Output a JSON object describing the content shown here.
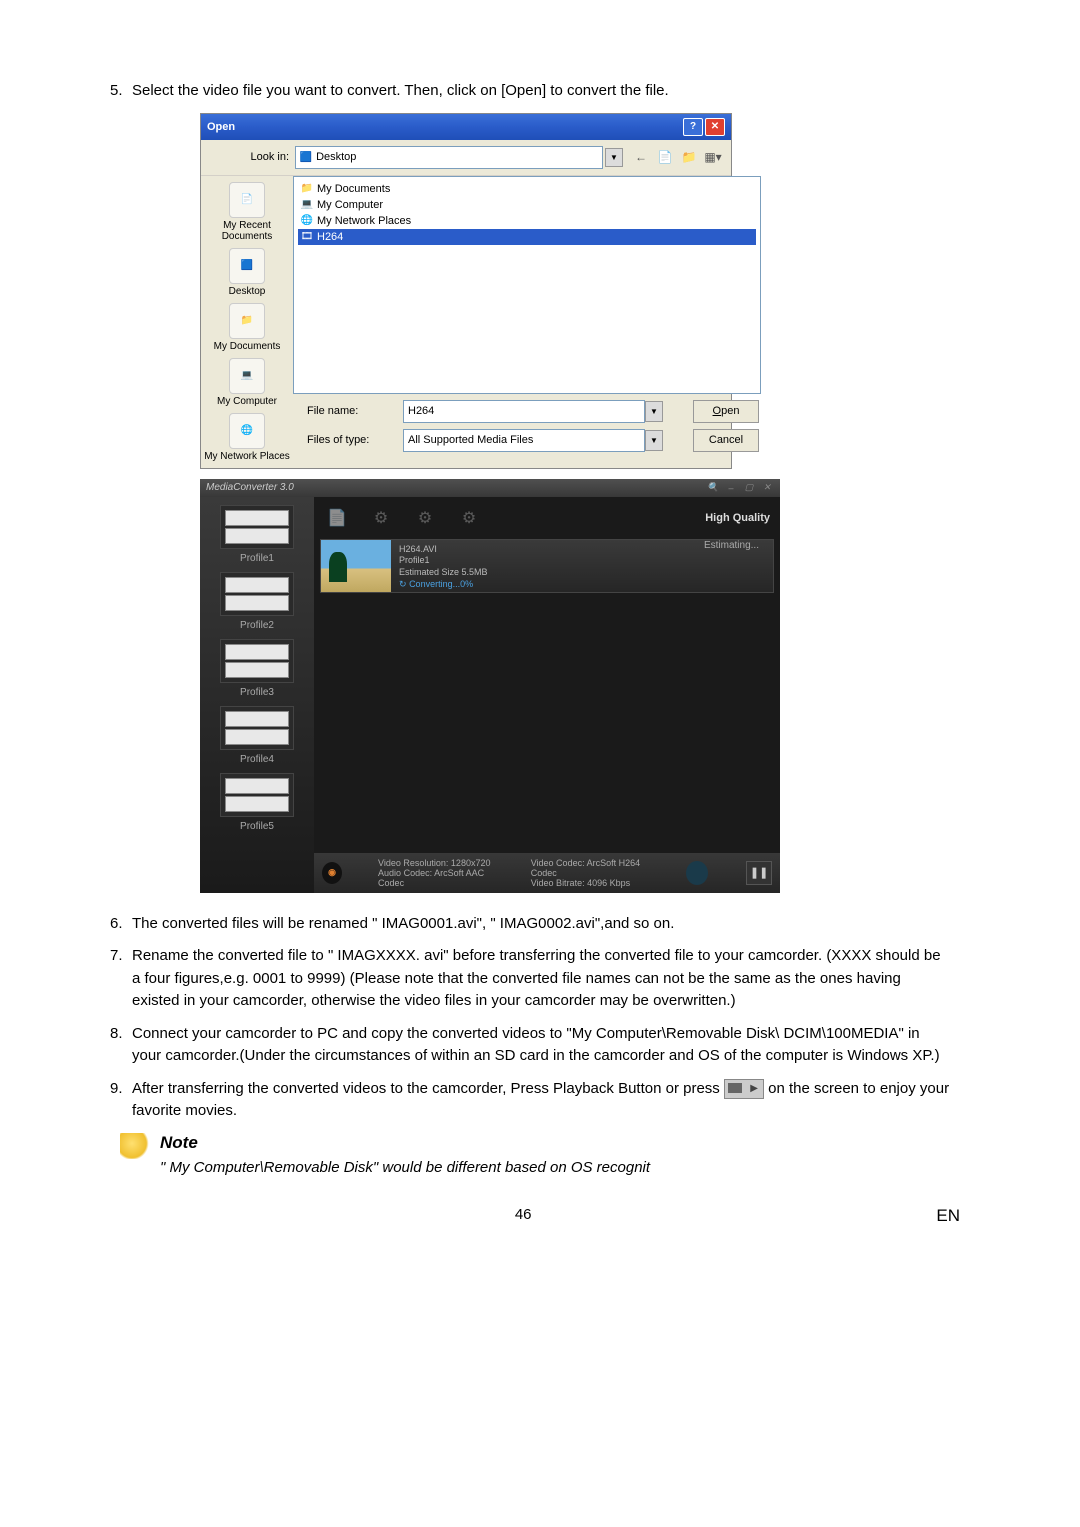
{
  "steps": {
    "5": "Select the video file you want to convert. Then, click on [Open] to convert the file.",
    "6": "The converted files will be renamed \" IMAG0001.avi\", \" IMAG0002.avi\",and so on.",
    "7": "Rename the converted file to \" IMAGXXXX. avi\" before transferring the converted file to your camcorder. (XXXX should be a four figures,e.g. 0001 to 9999) (Please note that the converted file names can not be the same as the ones having existed in your camcorder, otherwise the video files in your camcorder may be overwritten.)",
    "8": "Connect your camcorder to PC and copy the converted videos to \"My Computer\\Removable Disk\\ DCIM\\100MEDIA\" in your camcorder.(Under the circumstances of within an SD card in the camcorder and OS of the computer is Windows XP.)",
    "9a": "After transferring the converted videos to the camcorder, Press Playback Button or press ",
    "9b": " on the screen to enjoy your favorite movies."
  },
  "dlg": {
    "title": "Open",
    "lookin_label": "Look in:",
    "lookin_value": "Desktop",
    "items": {
      "mydocs": "My Documents",
      "mycomp": "My Computer",
      "mynet": "My Network Places",
      "h264": "H264"
    },
    "sidebar": {
      "recent": "My Recent Documents",
      "desktop": "Desktop",
      "mydocs": "My Documents",
      "mycomp": "My Computer",
      "mynet": "My Network Places"
    },
    "filename_label": "File name:",
    "filename_value": "H264",
    "filetype_label": "Files of type:",
    "filetype_value": "All Supported Media Files",
    "open_btn": "Open",
    "cancel_btn": "Cancel"
  },
  "mc": {
    "title": "MediaConverter 3.0",
    "hq": "High Quality",
    "profiles": {
      "1": "Profile1",
      "2": "Profile2",
      "3": "Profile3",
      "4": "Profile4",
      "5": "Profile5"
    },
    "item": {
      "name": "H264.AVI",
      "profile": "Profile1",
      "size": "Estimated Size 5.5MB",
      "conv": "Converting...0%",
      "est": "Estimating..."
    },
    "footer": {
      "res": "Video Resolution: 1280x720",
      "acodec": "Audio Codec: ArcSoft AAC Codec",
      "vcodec": "Video Codec: ArcSoft H264 Codec",
      "vbit": "Video Bitrate: 4096 Kbps"
    }
  },
  "note": {
    "label": "Note",
    "text": "\" My Computer\\Removable Disk\" would be different based on OS recognit"
  },
  "footer": {
    "page": "46",
    "lang": "EN"
  }
}
